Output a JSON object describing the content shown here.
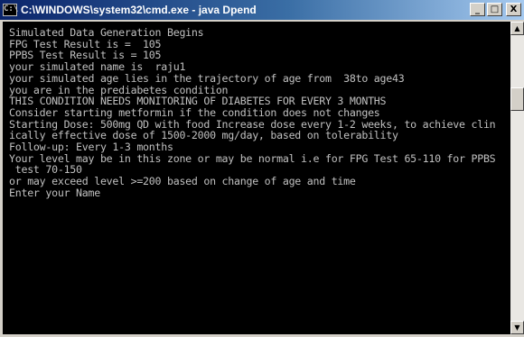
{
  "window": {
    "title": "C:\\WINDOWS\\system32\\cmd.exe - java Dpend",
    "icon": "cmd-icon",
    "icon_text": "C:\\",
    "controls": {
      "minimize": "_",
      "maximize": "□",
      "close": "X"
    }
  },
  "console": {
    "lines": [
      "Simulated Data Generation Begins",
      "FPG Test Result is =  105",
      "PPBS Test Result is = 105",
      "your simulated name is  raju1",
      "your simulated age lies in the trajectory of age from  38to age43",
      "you are in the prediabetes condition",
      "THIS CONDITION NEEDS MONITORING OF DIABETES FOR EVERY 3 MONTHS",
      "Consider starting metformin if the condition does not changes",
      "Starting Dose: 500mg QD with food Increase dose every 1-2 weeks, to achieve clin",
      "ically effective dose of 1500-2000 mg/day, based on tolerability",
      "Follow-up: Every 1-3 months",
      "Your level may be in this zone or may be normal i.e for FPG Test 65-110 for PPBS",
      " test 70-150",
      "or may exceed level >=200 based on change of age and time",
      "Enter your Name"
    ]
  },
  "scrollbar": {
    "up_arrow": "▲",
    "down_arrow": "▼",
    "position_fraction": 0.2
  }
}
